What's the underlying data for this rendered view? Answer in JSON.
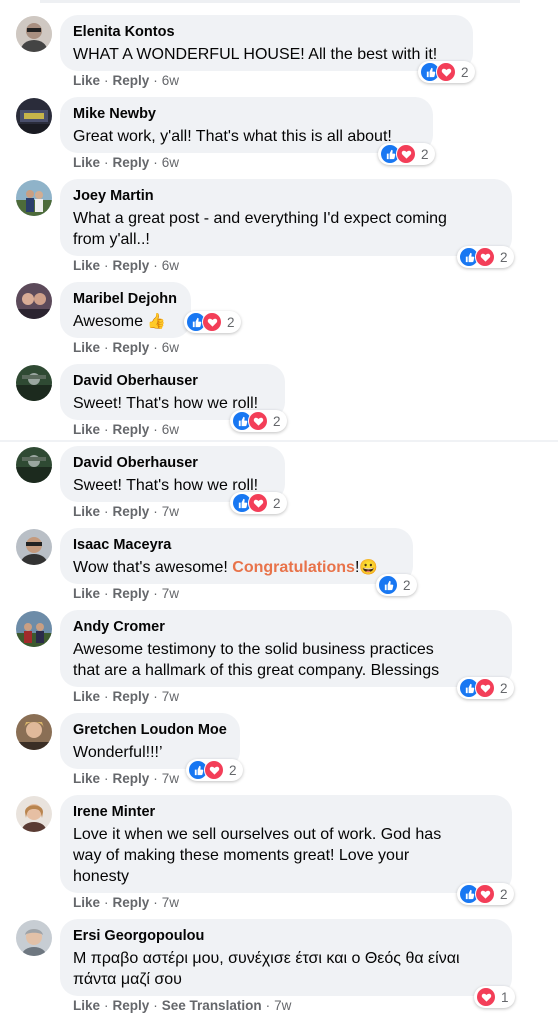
{
  "comments": [
    {
      "name": "Elenita Kontos",
      "text": "WHAT A WONDERFUL HOUSE! All the best with it!",
      "like": "Like",
      "reply": "Reply",
      "time": "6w",
      "reactions": "2"
    },
    {
      "name": "Mike Newby",
      "text": "Great work, y'all! That's what this is all about!",
      "like": "Like",
      "reply": "Reply",
      "time": "6w",
      "reactions": "2"
    },
    {
      "name": "Joey Martin",
      "text1": "What a great post - and everything I'd expect coming",
      "text2": "from y'all..!",
      "like": "Like",
      "reply": "Reply",
      "time": "6w",
      "reactions": "2"
    },
    {
      "name": "Maribel Dejohn",
      "text": "Awesome",
      "emoji": "👍",
      "like": "Like",
      "reply": "Reply",
      "time": "6w",
      "reactions": "2"
    },
    {
      "name": "David Oberhauser",
      "text": "Sweet! That's how we roll!",
      "like": "Like",
      "reply": "Reply",
      "time": "6w",
      "reactions": "2"
    },
    {
      "name": "David Oberhauser",
      "text": "Sweet! That's how we roll!",
      "like": "Like",
      "reply": "Reply",
      "time": "7w",
      "reactions": "2"
    },
    {
      "name": "Isaac Maceyra",
      "text": "Wow that's awesome!",
      "highlight": "Congratulations",
      "after": "!",
      "emoji": "😀",
      "like": "Like",
      "reply": "Reply",
      "time": "7w",
      "reactions": "2"
    },
    {
      "name": "Andy Cromer",
      "text1": "Awesome testimony to the solid business practices",
      "text2": "that are a hallmark of this great company. Blessings",
      "like": "Like",
      "reply": "Reply",
      "time": "7w",
      "reactions": "2"
    },
    {
      "name": "Gretchen Loudon Moe",
      "text": "Wonderful!!!’",
      "like": "Like",
      "reply": "Reply",
      "time": "7w",
      "reactions": "2"
    },
    {
      "name": "Irene Minter",
      "text1": "Love it when we sell ourselves out of work. God has",
      "text2": "way of making these moments great! Love your",
      "text3": "honesty",
      "like": "Like",
      "reply": "Reply",
      "time": "7w",
      "reactions": "2"
    },
    {
      "name": "Ersi Georgopoulou",
      "text1": "Μ πραβο αστέρι μου, συνέχισε έτσι και ο Θεός θα είναι",
      "text2": "πάντα μαζί σου",
      "like": "Like",
      "reply": "Reply",
      "translate": "See Translation",
      "time": "7w",
      "reactions": "1"
    }
  ],
  "sep": "·",
  "colors": {
    "bubble": "#f0f2f5",
    "like": "#1877f2",
    "love": "#f33e58",
    "meta": "#65676b",
    "highlight": "#e8734a"
  },
  "icons": {
    "like": "thumbs-up-icon",
    "love": "heart-icon"
  }
}
